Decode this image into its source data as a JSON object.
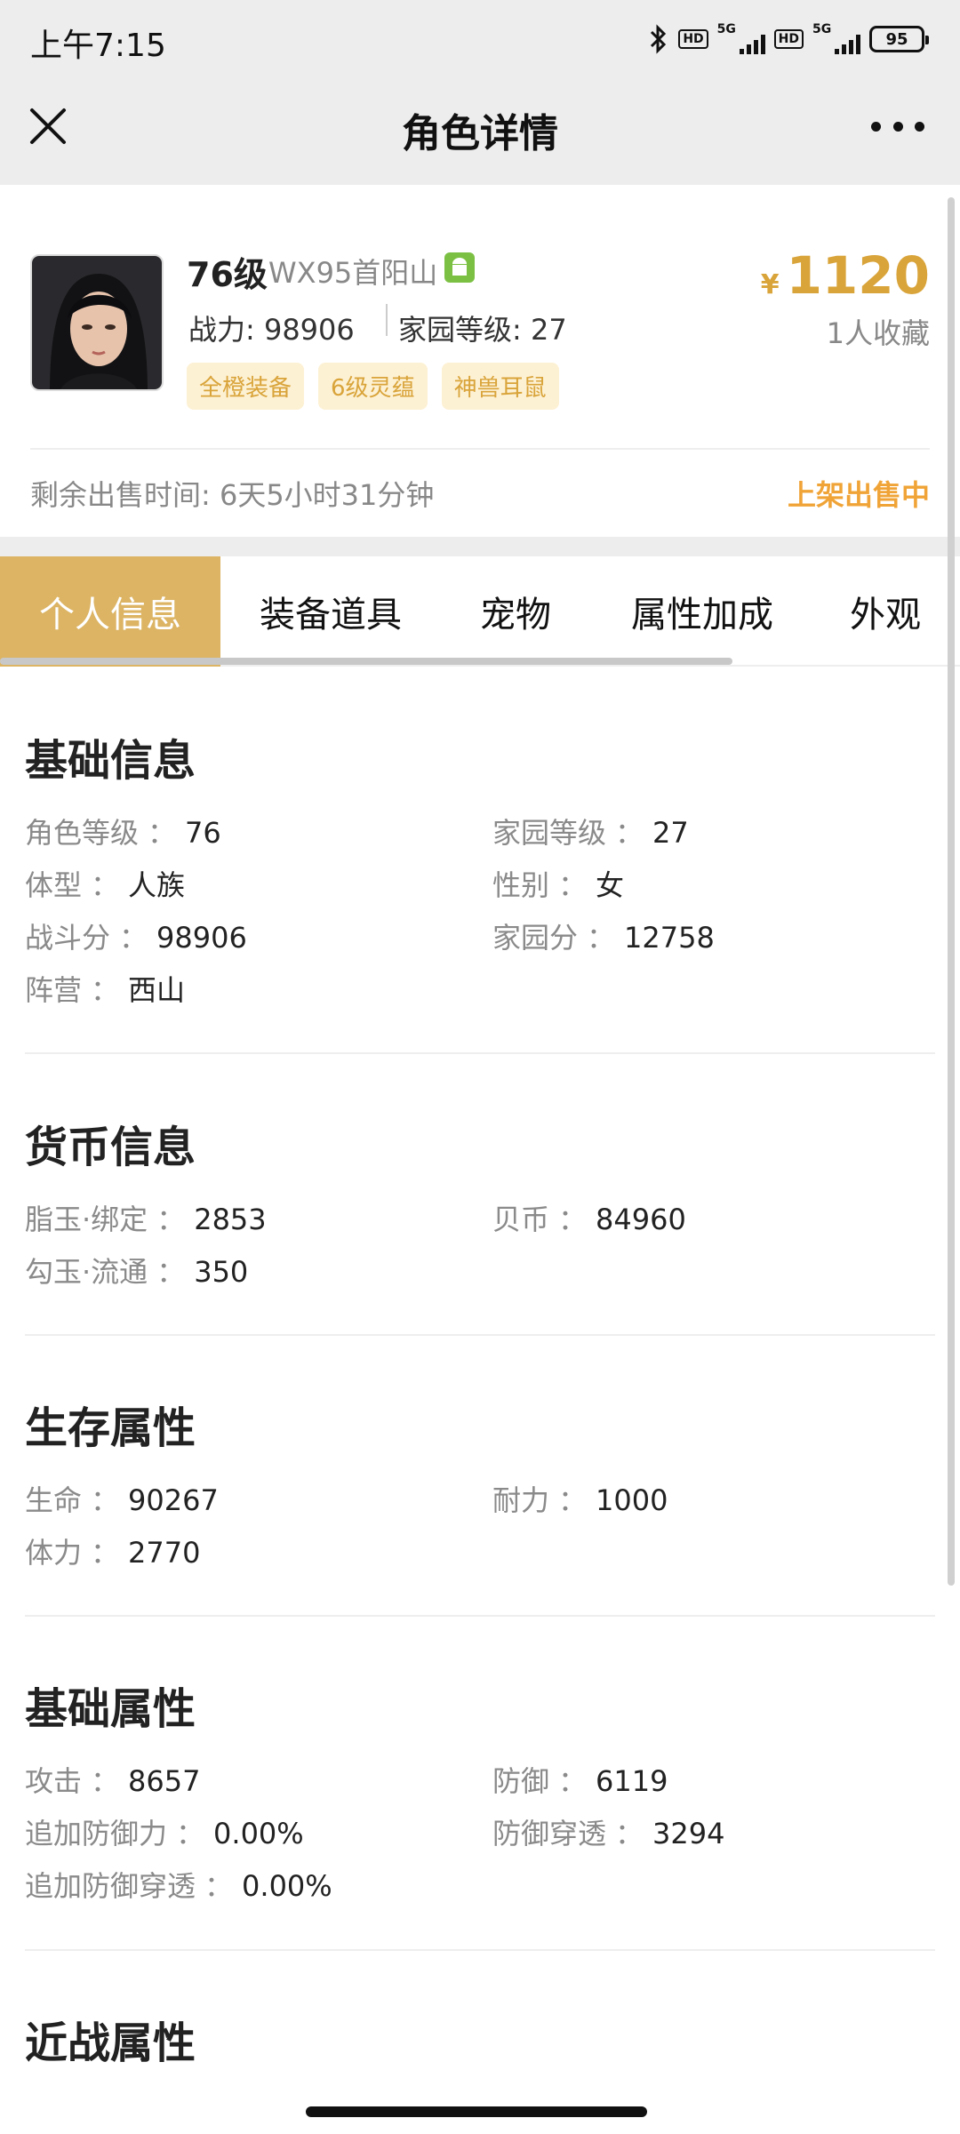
{
  "status": {
    "time": "上午7:15",
    "net1": "5G",
    "net2": "5G",
    "hd": "HD",
    "battery": "95"
  },
  "nav": {
    "title": "角色详情"
  },
  "role": {
    "level": "76级",
    "server": "WX95首阳山",
    "power": "战力: 98906",
    "home_level": "家园等级: 27",
    "tags": [
      "全橙装备",
      "6级灵蕴",
      "神兽耳鼠"
    ],
    "currency": "¥",
    "price": "1120",
    "favorites": "1人收藏",
    "remaining": "剩余出售时间: 6天5小时31分钟",
    "status": "上架出售中"
  },
  "tabs": [
    "个人信息",
    "装备道具",
    "宠物",
    "属性加成",
    "外观"
  ],
  "sections": [
    {
      "title": "基础信息",
      "rows": [
        {
          "k": "角色等级",
          "v": "76"
        },
        {
          "k": "家园等级",
          "v": "27"
        },
        {
          "k": "体型",
          "v": "人族"
        },
        {
          "k": "性别",
          "v": "女"
        },
        {
          "k": "战斗分",
          "v": "98906"
        },
        {
          "k": "家园分",
          "v": "12758"
        },
        {
          "k": "阵营",
          "v": "西山"
        }
      ]
    },
    {
      "title": "货币信息",
      "rows": [
        {
          "k": "脂玉·绑定",
          "v": "2853"
        },
        {
          "k": "贝币",
          "v": "84960"
        },
        {
          "k": "勾玉·流通",
          "v": "350"
        }
      ]
    },
    {
      "title": "生存属性",
      "rows": [
        {
          "k": "生命",
          "v": "90267"
        },
        {
          "k": "耐力",
          "v": "1000"
        },
        {
          "k": "体力",
          "v": "2770"
        }
      ]
    },
    {
      "title": "基础属性",
      "rows": [
        {
          "k": "攻击",
          "v": "8657"
        },
        {
          "k": "防御",
          "v": "6119"
        },
        {
          "k": "追加防御力",
          "v": "0.00%"
        },
        {
          "k": "防御穿透",
          "v": "3294"
        },
        {
          "k": "追加防御穿透",
          "v": "0.00%"
        }
      ]
    },
    {
      "title": "近战属性",
      "rows": []
    }
  ],
  "colon": "："
}
